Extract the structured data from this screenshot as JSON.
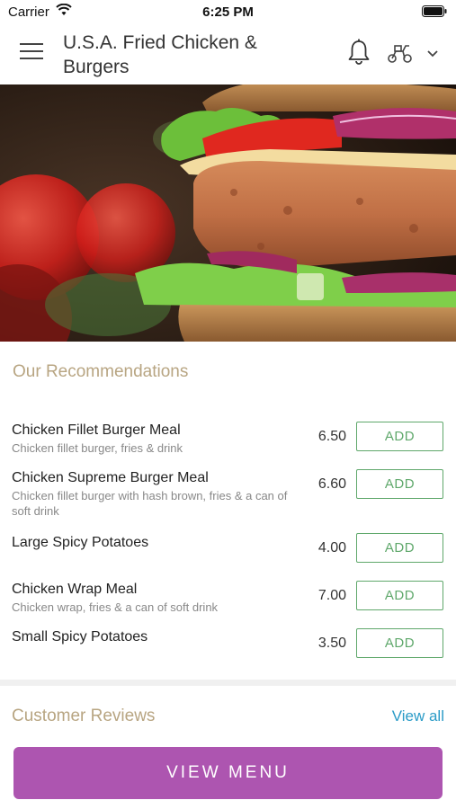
{
  "status_bar": {
    "carrier": "Carrier",
    "time": "6:25 PM"
  },
  "header": {
    "title": "U.S.A. Fried Chicken & Burgers"
  },
  "recommendations": {
    "title": "Our Recommendations",
    "items": [
      {
        "name": "Chicken Fillet Burger Meal",
        "description": "Chicken fillet burger, fries & drink",
        "price": "6.50",
        "button": "ADD"
      },
      {
        "name": "Chicken Supreme Burger Meal",
        "description": "Chicken fillet burger with hash brown, fries & a can of soft drink",
        "price": "6.60",
        "button": "ADD"
      },
      {
        "name": "Large Spicy Potatoes",
        "description": "",
        "price": "4.00",
        "button": "ADD"
      },
      {
        "name": "Chicken Wrap Meal",
        "description": "Chicken wrap, fries & a can of soft drink",
        "price": "7.00",
        "button": "ADD"
      },
      {
        "name": "Small Spicy Potatoes",
        "description": "",
        "price": "3.50",
        "button": "ADD"
      }
    ]
  },
  "reviews": {
    "title": "Customer Reviews",
    "view_all": "View all"
  },
  "footer": {
    "view_menu": "VIEW MENU"
  },
  "colors": {
    "accent": "#ad55b0",
    "add_green": "#5fa86b",
    "heading_gold": "#b8a582",
    "link_blue": "#2a9bc7"
  },
  "icons": [
    "menu-icon",
    "bell-icon",
    "delivery-scooter-icon",
    "chevron-down-icon",
    "wifi-icon",
    "battery-icon"
  ]
}
